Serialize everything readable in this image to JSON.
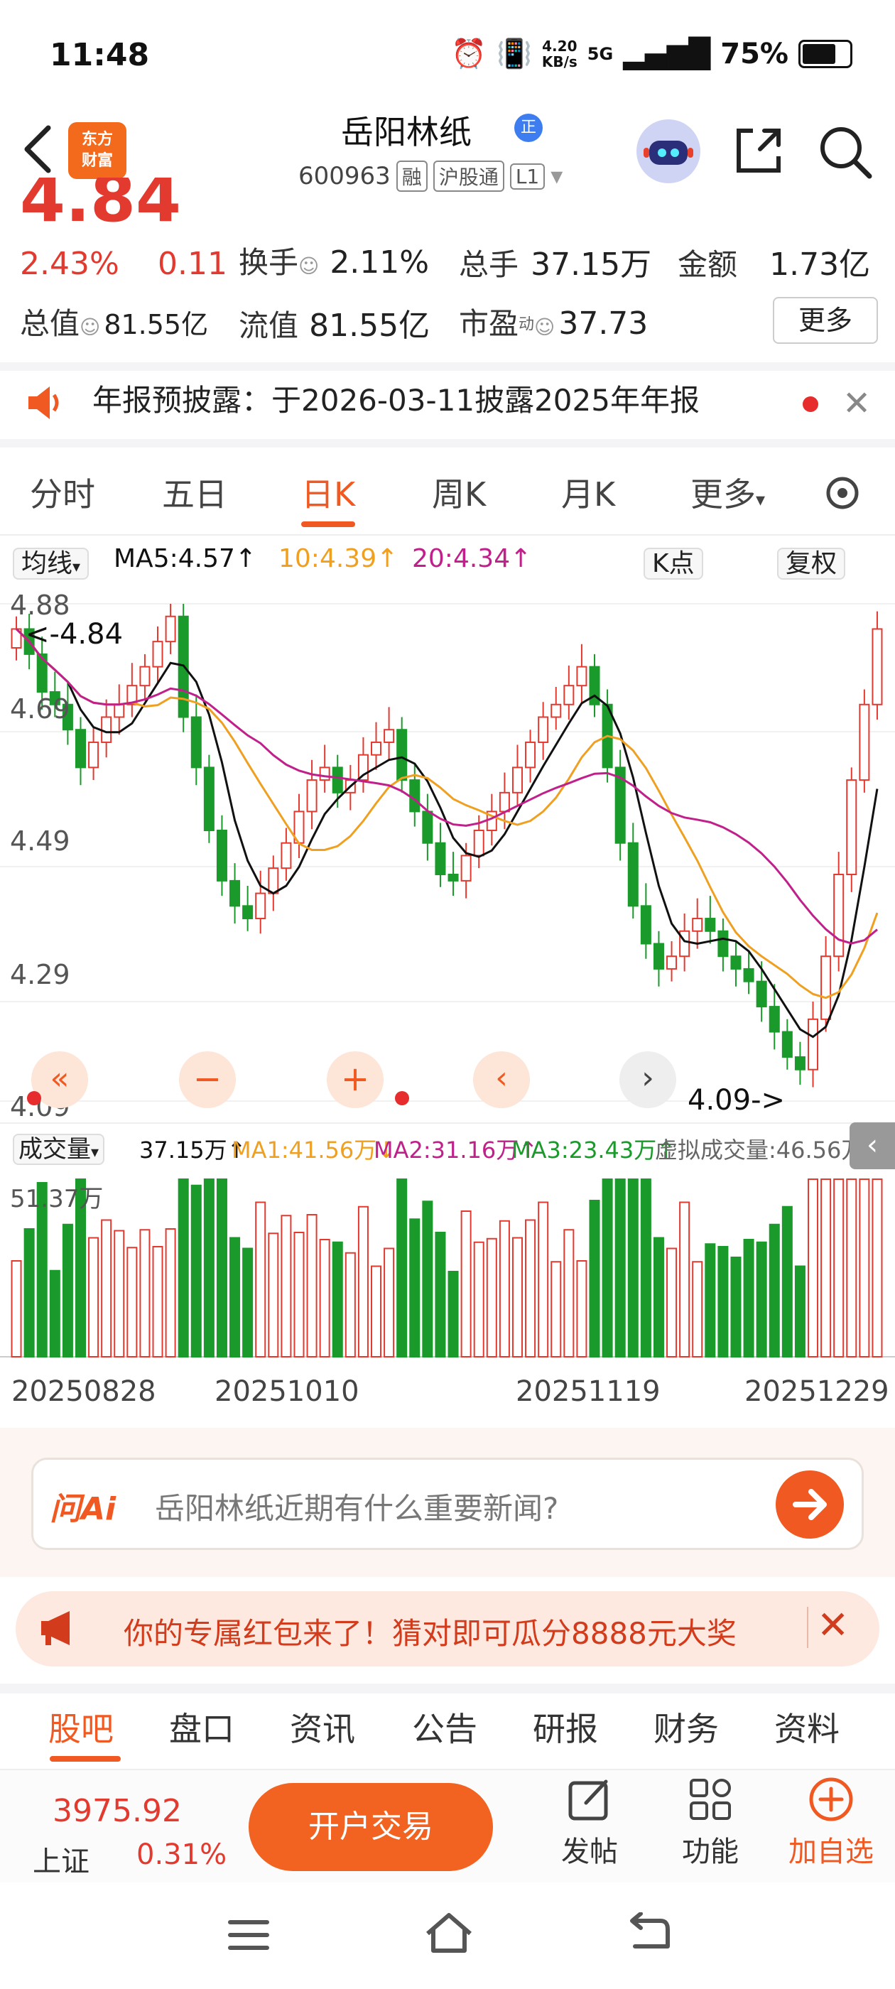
{
  "status": {
    "time": "11:48",
    "net_speed_top": "4.20",
    "net_speed_bottom": "KB/s",
    "signal": "5G",
    "battery": "75%"
  },
  "header": {
    "logo_line1": "东方",
    "logo_line2": "财富",
    "stock_name": "岳阳林纸",
    "badge": "正",
    "stock_code": "600963",
    "tag1": "融",
    "tag2": "沪股通",
    "tag3": "L1"
  },
  "quote": {
    "price": "4.84",
    "change_pct": "2.43%",
    "change_abs": "0.11",
    "turnover_label": "换手",
    "turnover": "2.11%",
    "volume_label": "总手",
    "volume": "37.15万",
    "amount_label": "金额",
    "amount": "1.73亿",
    "mktcap_label": "总值",
    "mktcap": "81.55亿",
    "float_label": "流值",
    "float_cap": "81.55亿",
    "pe_label": "市盈",
    "pe_sup": "动",
    "pe": "37.73",
    "more": "更多"
  },
  "notice": {
    "text": "年报预披露：于2026-03-11披露2025年年报"
  },
  "chart_tabs": [
    "分时",
    "五日",
    "日K",
    "周K",
    "月K",
    "更多"
  ],
  "active_tab": "日K",
  "indicators": {
    "ma_label": "均线",
    "ma5": "MA5:4.57↑",
    "ma10": "10:4.39↑",
    "ma20": "20:4.34↑",
    "point_btn": "K点",
    "fq_btn": "复权"
  },
  "chart_labels": {
    "high": "4.88",
    "mid1": "4.69",
    "mid2": "4.49",
    "mid3": "4.29",
    "low": "4.09",
    "max_tag": "<-4.84",
    "min_tag": "4.09->",
    "vol_max": "51.37万"
  },
  "volume_line": {
    "label": "成交量",
    "vol": "37.15万↑",
    "ma1": "MA1:41.56万↓",
    "ma2": "MA2:31.16万↑",
    "ma3": "MA3:23.43万↑",
    "virtual": "虚拟成交量:46.56万"
  },
  "dates": [
    "20250828",
    "20251010",
    "20251119",
    "20251229"
  ],
  "ai": {
    "logo": "问Ai",
    "prompt": "岳阳林纸近期有什么重要新闻?"
  },
  "promo": {
    "text": "你的专属红包来了！猜对即可瓜分8888元大奖"
  },
  "bottom_tabs": [
    "股吧",
    "盘口",
    "资讯",
    "公告",
    "研报",
    "财务",
    "资料"
  ],
  "footer": {
    "index_value": "3975.92",
    "index_name": "上证",
    "index_pct": "0.31%",
    "trade_btn": "开户交易",
    "post": "发帖",
    "func": "功能",
    "add": "加自选"
  },
  "colors": {
    "up": "#e33a30",
    "down": "#1a9a2a",
    "accent": "#f05a22",
    "ma5": "#111111",
    "ma10": "#f0a020",
    "ma20": "#c0208a"
  },
  "chart_data": {
    "type": "candlestick",
    "x_range": [
      "20250828",
      "20251229"
    ],
    "ylim": [
      4.09,
      4.88
    ],
    "close_series": [
      4.84,
      4.8,
      4.74,
      4.72,
      4.68,
      4.62,
      4.66,
      4.7,
      4.72,
      4.75,
      4.78,
      4.82,
      4.86,
      4.7,
      4.62,
      4.52,
      4.44,
      4.4,
      4.38,
      4.42,
      4.46,
      4.5,
      4.55,
      4.6,
      4.62,
      4.58,
      4.6,
      4.64,
      4.66,
      4.68,
      4.6,
      4.55,
      4.5,
      4.45,
      4.44,
      4.48,
      4.52,
      4.55,
      4.58,
      4.62,
      4.66,
      4.7,
      4.72,
      4.75,
      4.78,
      4.72,
      4.62,
      4.5,
      4.4,
      4.34,
      4.3,
      4.32,
      4.36,
      4.38,
      4.36,
      4.32,
      4.3,
      4.28,
      4.24,
      4.2,
      4.16,
      4.14,
      4.22,
      4.32,
      4.45,
      4.6,
      4.72,
      4.84
    ]
  }
}
